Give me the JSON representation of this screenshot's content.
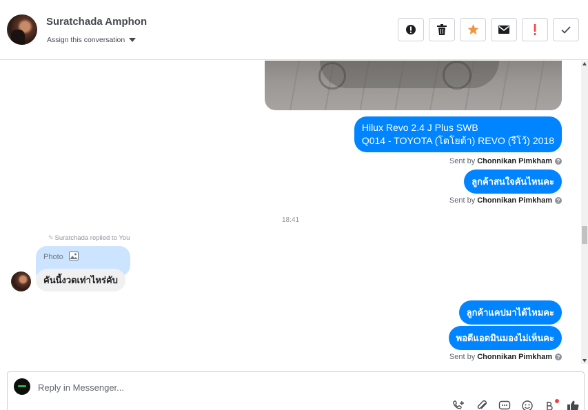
{
  "header": {
    "contact_name": "Suratchada Amphon",
    "assign_label": "Assign this conversation",
    "actions": [
      {
        "name": "mark-spam",
        "icon": "alert-circle-icon"
      },
      {
        "name": "delete",
        "icon": "trash-icon"
      },
      {
        "name": "star",
        "icon": "star-icon",
        "color": "#f7923b"
      },
      {
        "name": "mark-unread",
        "icon": "envelope-icon"
      },
      {
        "name": "follow-up",
        "icon": "exclamation-icon",
        "color": "#fa3e3e"
      },
      {
        "name": "mark-done",
        "icon": "check-icon"
      }
    ]
  },
  "messages": {
    "photo": {
      "icon": "car-photo"
    },
    "out_1": {
      "line1": "Hilux Revo 2.4 J Plus SWB",
      "line2": "Q014 - TOYOTA (โตโยต้า) REVO (รีโว้) 2018"
    },
    "sent_by_1": {
      "prefix": "Sent by",
      "agent": "Chonnikan Pimkham"
    },
    "out_2": "ลูกค้าสนใจคันไหนคะ",
    "sent_by_2": {
      "prefix": "Sent by",
      "agent": "Chonnikan Pimkham"
    },
    "timestamp": "18:41",
    "reply_note": "Suratchada replied to You",
    "quoted_label": "Photo",
    "in_1": "คันนี้งวดเท่าไหร่คับ",
    "out_3": "ลูกค้าแคปมาได้ไหมคะ",
    "out_4": "พอดีแอดมินมองไม่เห็นคะ",
    "sent_by_3": {
      "prefix": "Sent by",
      "agent": "Chonnikan Pimkham"
    }
  },
  "composer": {
    "placeholder": "Reply in Messenger...",
    "tools": [
      "call-add-icon",
      "attachment-icon",
      "saved-replies-icon",
      "emoji-icon",
      "currency-icon",
      "like-icon"
    ]
  },
  "colors": {
    "outgoing_bubble": "#0084ff",
    "incoming_bubble": "#f1f0f0",
    "quoted_bubble": "#cce4ff"
  }
}
